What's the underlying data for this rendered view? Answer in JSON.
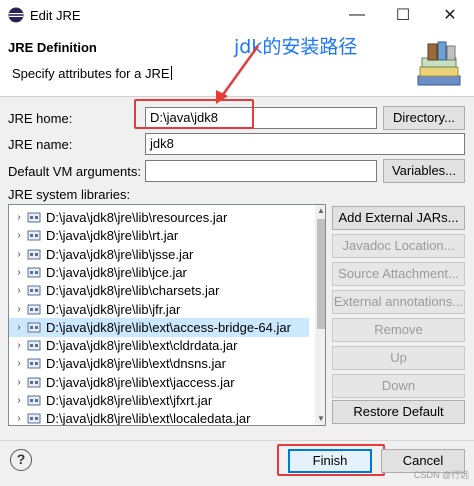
{
  "window": {
    "title": "Edit JRE",
    "min": "—",
    "max": "☐",
    "close": "✕"
  },
  "header": {
    "title": "JRE Definition",
    "description": "Specify attributes for a JRE",
    "annotation": "jdk的安装路径"
  },
  "form": {
    "jre_home_label": "JRE home:",
    "jre_home_value": "D:\\java\\jdk8",
    "directory_button": "Directory...",
    "jre_name_label": "JRE name:",
    "jre_name_value": "jdk8",
    "vm_args_label": "Default VM arguments:",
    "vm_args_value": "",
    "variables_button": "Variables...",
    "libraries_label": "JRE system libraries:"
  },
  "libraries": [
    "D:\\java\\jdk8\\jre\\lib\\resources.jar",
    "D:\\java\\jdk8\\jre\\lib\\rt.jar",
    "D:\\java\\jdk8\\jre\\lib\\jsse.jar",
    "D:\\java\\jdk8\\jre\\lib\\jce.jar",
    "D:\\java\\jdk8\\jre\\lib\\charsets.jar",
    "D:\\java\\jdk8\\jre\\lib\\jfr.jar",
    "D:\\java\\jdk8\\jre\\lib\\ext\\access-bridge-64.jar",
    "D:\\java\\jdk8\\jre\\lib\\ext\\cldrdata.jar",
    "D:\\java\\jdk8\\jre\\lib\\ext\\dnsns.jar",
    "D:\\java\\jdk8\\jre\\lib\\ext\\jaccess.jar",
    "D:\\java\\jdk8\\jre\\lib\\ext\\jfxrt.jar",
    "D:\\java\\jdk8\\jre\\lib\\ext\\localedata.jar"
  ],
  "selected_library": 6,
  "library_buttons": {
    "add_external": "Add External JARs...",
    "javadoc": "Javadoc Location...",
    "source": "Source Attachment...",
    "external_annotations": "External annotations...",
    "remove": "Remove",
    "up": "Up",
    "down": "Down",
    "restore": "Restore Default"
  },
  "footer": {
    "help": "?",
    "finish": "Finish",
    "cancel": "Cancel",
    "watermark": "CSDN @行远"
  },
  "colors": {
    "annotation_blue": "#1a75ff",
    "highlight_red": "#e53b3b",
    "selection": "#cce8ff"
  }
}
